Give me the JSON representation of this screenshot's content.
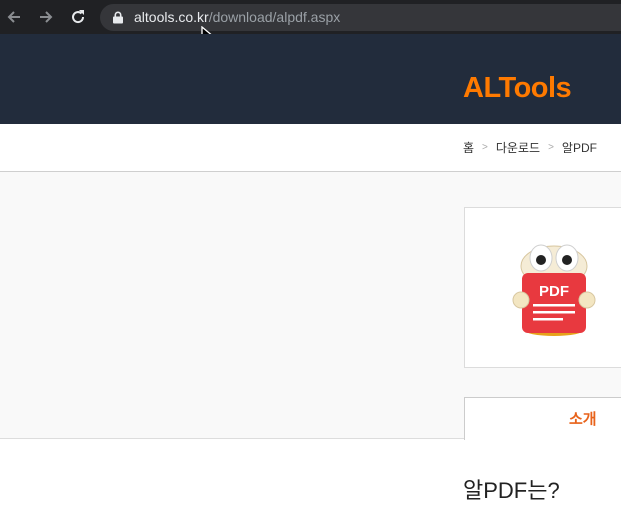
{
  "browser": {
    "url_host": "altools.co.kr",
    "url_path": "/download/alpdf.aspx",
    "back_icon": "arrow-left-icon",
    "forward_icon": "arrow-right-icon",
    "reload_icon": "reload-icon",
    "lock_icon": "lock-icon"
  },
  "site": {
    "logo": "ALTools",
    "brand_color": "#ff7a00"
  },
  "breadcrumb": {
    "items": [
      "홈",
      "다운로드",
      "알PDF"
    ],
    "separator": ">"
  },
  "product": {
    "mascot_label": "PDF"
  },
  "tabs": [
    {
      "label": "소개",
      "active": true
    }
  ],
  "section": {
    "title": "알PDF는?"
  }
}
